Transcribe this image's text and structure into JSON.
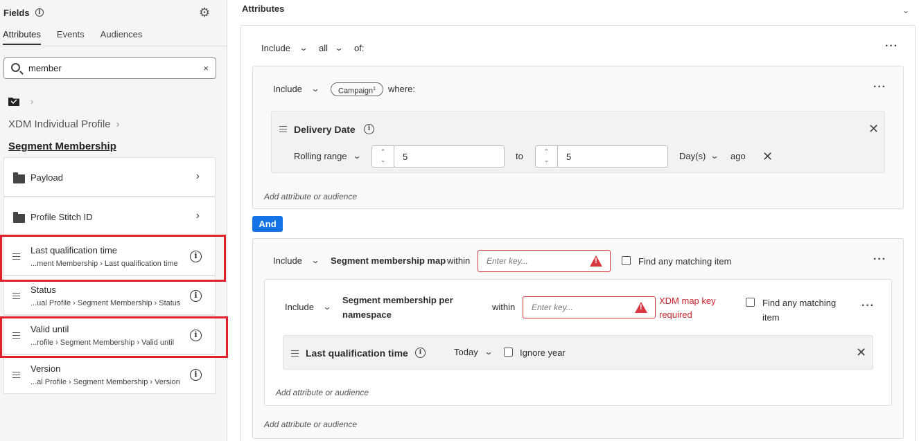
{
  "left": {
    "title": "Fields",
    "tabs": [
      "Attributes",
      "Events",
      "Audiences"
    ],
    "search": {
      "value": "member",
      "clear": "×"
    },
    "breadcrumb": [
      "XDM Individual Profile"
    ],
    "current": "Segment Membership",
    "items": [
      {
        "label": "Payload"
      },
      {
        "label": "Profile Stitch ID"
      },
      {
        "label": "Last qualification time",
        "path": "...ment Membership › Last qualification time"
      },
      {
        "label": "Status",
        "path": "...ual Profile › Segment Membership › Status"
      },
      {
        "label": "Valid until",
        "path": "...rofile › Segment Membership › Valid until"
      },
      {
        "label": "Version",
        "path": "...al Profile › Segment Membership › Version"
      }
    ]
  },
  "right": {
    "title": "Attributes",
    "top": {
      "include": "Include",
      "quantifier": "all",
      "of": "of:"
    },
    "group1": {
      "include": "Include",
      "pill": "Campaign",
      "pill_count": "1",
      "where": "where:",
      "condition": {
        "title": "Delivery Date",
        "operator": "Rolling range",
        "from": "5",
        "to_label": "to",
        "to": "5",
        "unit": "Day(s)",
        "suffix": "ago"
      },
      "add": "Add attribute or audience"
    },
    "and_label": "And",
    "group2": {
      "include": "Include",
      "name": "Segment membership map",
      "within": "within",
      "key_placeholder": "Enter key...",
      "find_any": "Find any matching item",
      "nested": {
        "include": "Include",
        "name_line1": "Segment membership per",
        "name_line2": "namespace",
        "within": "within",
        "key_placeholder": "Enter key...",
        "error_line1": "XDM map key",
        "error_line2": "required",
        "find_line1": "Find any matching",
        "find_line2": "item",
        "condition": {
          "title": "Last qualification time",
          "operator": "Today",
          "ignore_year": "Ignore year"
        },
        "add": "Add attribute or audience"
      },
      "add": "Add attribute or audience"
    }
  }
}
